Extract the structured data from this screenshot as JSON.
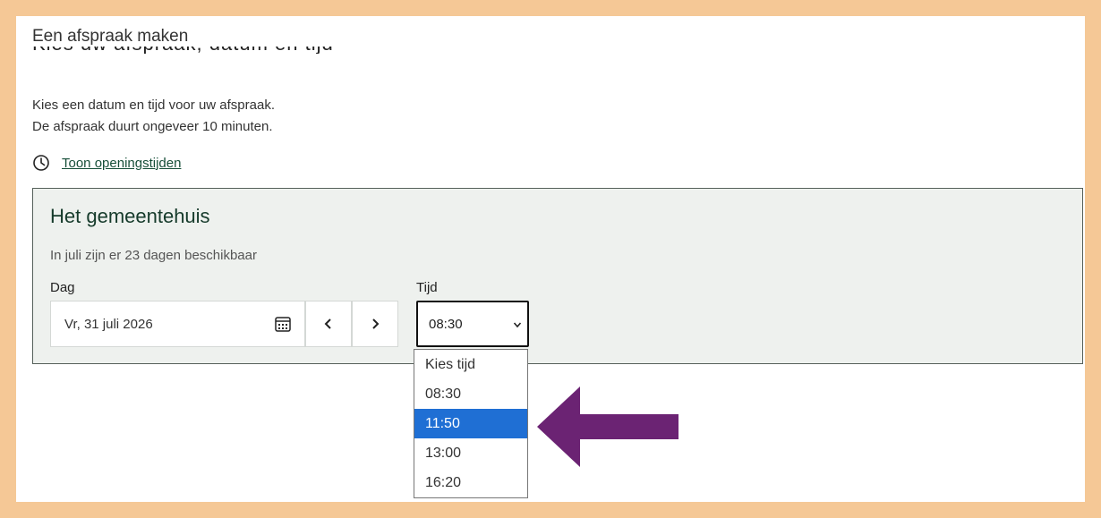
{
  "header": {
    "title": "Een afspraak maken",
    "cut_text": "Kies uw afspraak, datum en tijd"
  },
  "intro": {
    "line1": "Kies een datum en tijd voor uw afspraak.",
    "line2": "De afspraak duurt ongeveer 10 minuten."
  },
  "hours_link": "Toon openingstijden",
  "location": {
    "name": "Het gemeentehuis",
    "availability": "In juli zijn er 23 dagen beschikbaar",
    "day_label": "Dag",
    "day_value": "Vr, 31 juli 2026",
    "time_label": "Tijd",
    "time_value": "08:30"
  },
  "dropdown": {
    "options": [
      "Kies tijd",
      "08:30",
      "11:50",
      "13:00",
      "16:20"
    ],
    "highlighted": "11:50"
  },
  "colors": {
    "highlight": "#1f6fd4",
    "arrow": "#6b2373",
    "border_frame": "#f5c896",
    "link": "#164e38"
  },
  "icons": [
    "clock-icon",
    "calendar-icon",
    "chevron-left-icon",
    "chevron-right-icon",
    "chevron-down-icon",
    "arrow-left-icon"
  ]
}
